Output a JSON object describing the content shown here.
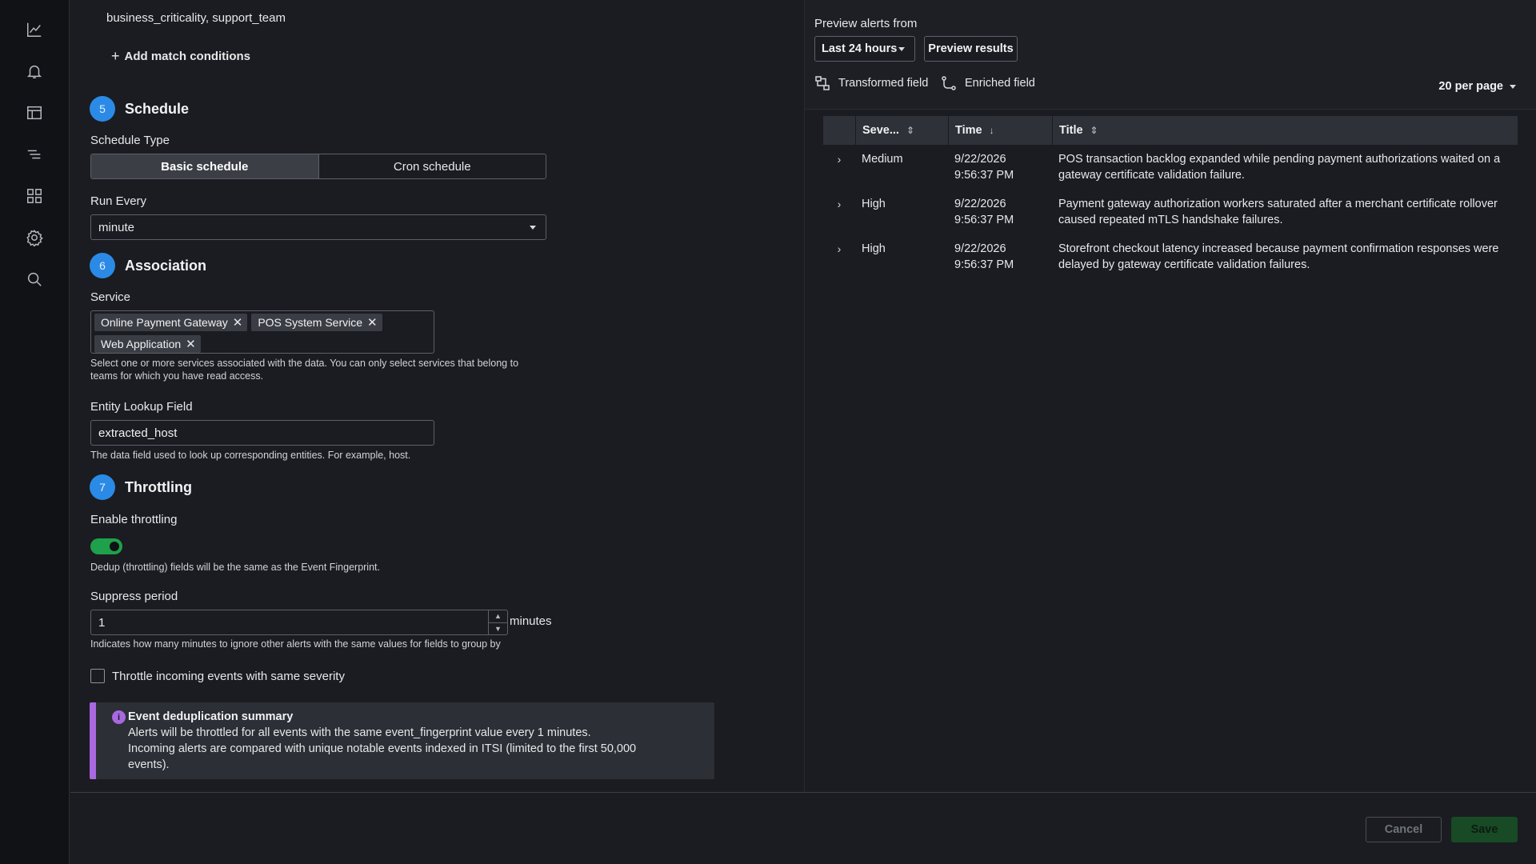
{
  "nav": {
    "icons": [
      "chart-line-icon",
      "bell-icon",
      "layout-icon",
      "list-icon",
      "apps-grid-icon",
      "gear-icon",
      "search-icon"
    ]
  },
  "form": {
    "group_by_value": "business_criticality, support_team",
    "add_match_conditions_label": "Add match conditions",
    "schedule": {
      "step": "5",
      "title": "Schedule",
      "type_label": "Schedule Type",
      "options": [
        "Basic schedule",
        "Cron schedule"
      ],
      "selected": "Basic schedule",
      "run_every_label": "Run Every",
      "run_every_value": "minute"
    },
    "association": {
      "step": "6",
      "title": "Association",
      "service_label": "Service",
      "services": [
        "Online Payment Gateway",
        "POS System Service",
        "Web Application"
      ],
      "service_help": "Select one or more services associated with the data. You can only select services that belong to teams for which you have read access.",
      "entity_label": "Entity Lookup Field",
      "entity_value": "extracted_host",
      "entity_help": "The data field used to look up corresponding entities. For example, host."
    },
    "throttling": {
      "step": "7",
      "title": "Throttling",
      "enable_label": "Enable throttling",
      "enabled": true,
      "dedup_help": "Dedup (throttling) fields will be the same as the Event Fingerprint.",
      "suppress_label": "Suppress period",
      "suppress_value": "1",
      "suppress_units": "minutes",
      "suppress_help": "Indicates how many minutes to ignore other alerts with the same values for fields to group by",
      "same_severity_label": "Throttle incoming events with same severity",
      "same_severity_checked": false
    },
    "summary": {
      "title": "Event deduplication summary",
      "line1": "Alerts will be throttled for all events with the same event_fingerprint value every 1 minutes.",
      "line2": "Incoming alerts are compared with unique notable events indexed in ITSI (limited to the first 50,000 events)."
    }
  },
  "preview": {
    "label": "Preview alerts from",
    "range": "Last 24 hours",
    "preview_button": "Preview results",
    "legend": [
      "Transformed field",
      "Enriched field"
    ],
    "per_page": "20 per page",
    "columns": [
      "Seve...",
      "Time",
      "Title"
    ],
    "rows": [
      {
        "severity": "Medium",
        "date": "9/22/2026",
        "time": "9:56:37 PM",
        "title": "POS transaction backlog expanded while pending payment authorizations waited on a gateway certificate validation failure."
      },
      {
        "severity": "High",
        "date": "9/22/2026",
        "time": "9:56:37 PM",
        "title": "Payment gateway authorization workers saturated after a merchant certificate rollover caused repeated mTLS handshake failures."
      },
      {
        "severity": "High",
        "date": "9/22/2026",
        "time": "9:56:37 PM",
        "title": "Storefront checkout latency increased because payment confirmation responses were delayed by gateway certificate validation failures."
      }
    ]
  },
  "footer": {
    "cancel": "Cancel",
    "save": "Save"
  },
  "colors": {
    "accent_blue": "#2b8ae6",
    "toggle_green": "#1fa04b",
    "info_purple": "#a868e0",
    "save_green": "#184a25"
  }
}
